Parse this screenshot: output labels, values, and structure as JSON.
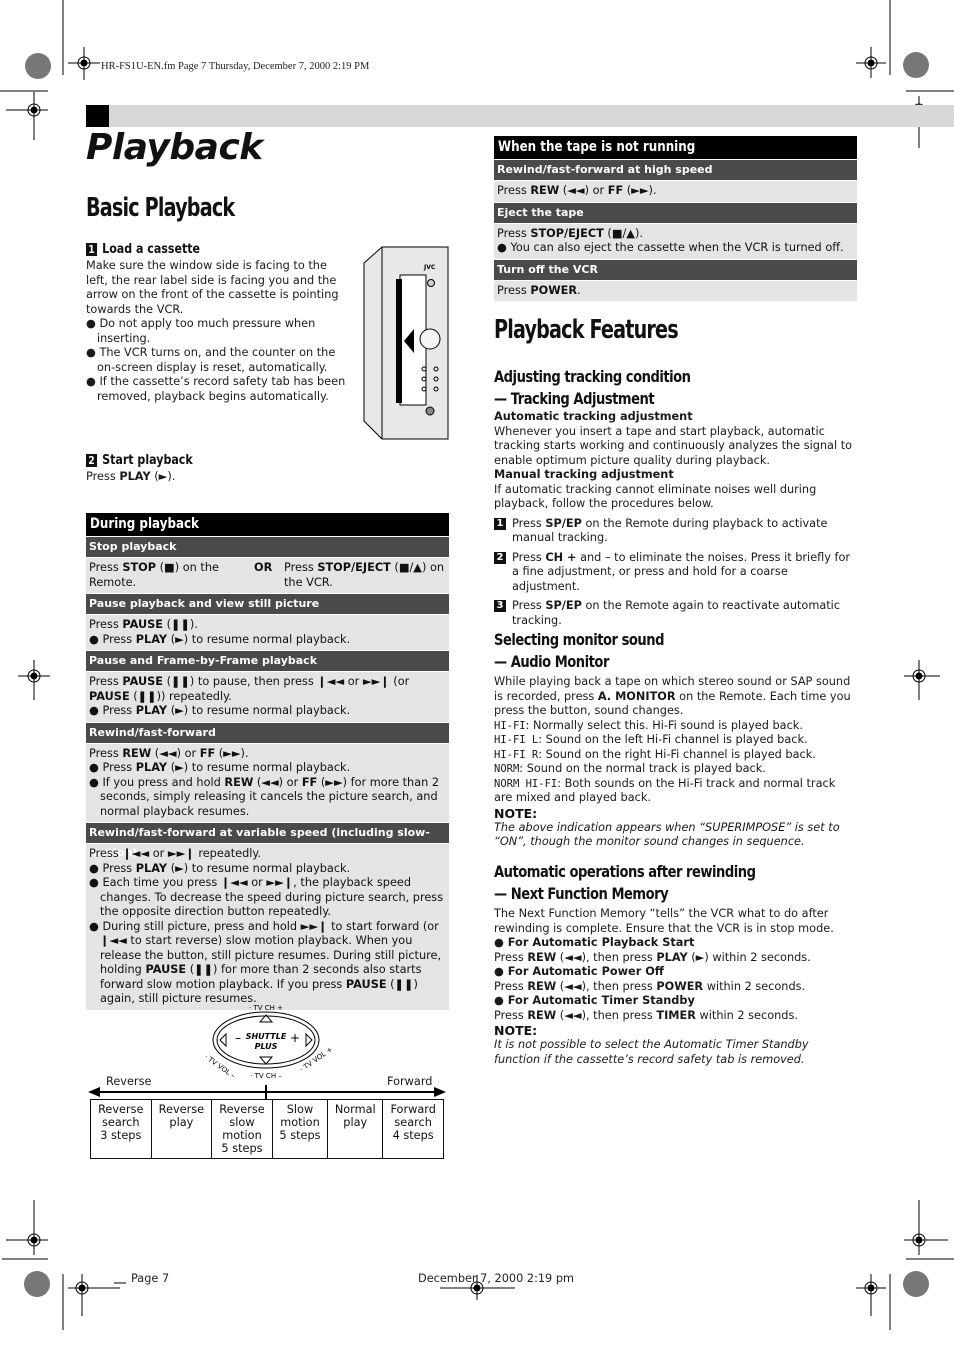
{
  "print_header": "HR-FS1U-EN.fm  Page 7  Thursday, December 7, 2000  2:19 PM",
  "page_title": "Playback",
  "left": {
    "section_title": "Basic Playback",
    "steps": [
      {
        "num": "1",
        "title": "Load a cassette",
        "text": "Make sure the window side is facing to the left, the rear label side is facing you and the arrow on the front of the cassette is pointing towards the VCR.",
        "bullets": [
          "Do not apply too much pressure when inserting.",
          "The VCR turns on, and the counter on the on-screen display is reset, automatically.",
          "If the cassette’s record safety tab has been removed, playback begins automatically."
        ]
      },
      {
        "num": "2",
        "title": "Start playback",
        "text_pre": "Press ",
        "text_bold": "PLAY",
        "text_post": " (►)."
      }
    ],
    "vcr_brand": "JVC",
    "during_table": {
      "title": "During playback",
      "stop": {
        "heading": "Stop playback",
        "left_pre": "Press ",
        "left_bold": "STOP",
        "left_post": " (■) on the Remote.",
        "or": "OR",
        "right_pre": "Press ",
        "right_bold": "STOP/EJECT",
        "right_post": " (■/▲) on the VCR."
      },
      "pause": {
        "heading": "Pause playback and view still picture",
        "line_pre": "Press ",
        "line_bold": "PAUSE",
        "line_post": " (❚❚).",
        "bullet_pre": "Press ",
        "bullet_bold": "PLAY",
        "bullet_post": " (►) to resume normal playback."
      },
      "frame": {
        "heading": "Pause and Frame-by-Frame playback",
        "line_pre": "Press ",
        "line_bold": "PAUSE",
        "line_mid": " (❚❚) to pause, then press ❙◄◄ or ►►❙ (or ",
        "line_bold2": "PAUSE",
        "line_post": " (❚❚)) repeatedly.",
        "bullet_pre": "Press ",
        "bullet_bold": "PLAY",
        "bullet_post": " (►) to resume normal playback."
      },
      "rewff": {
        "heading": "Rewind/fast-forward",
        "line_pre": "Press ",
        "line_bold": "REW",
        "line_mid": " (◄◄) or ",
        "line_bold2": "FF",
        "line_post": " (►►).",
        "bullet1_pre": "Press ",
        "bullet1_bold": "PLAY",
        "bullet1_post": " (►) to resume normal playback.",
        "bullet2_pre": "If you press and hold ",
        "bullet2_bold": "REW",
        "bullet2_mid": " (◄◄) or ",
        "bullet2_bold2": "FF",
        "bullet2_post": " (►►) for more than 2 seconds, simply releasing it cancels the picture search, and normal playback resumes."
      },
      "variable": {
        "heading": "Rewind/fast-forward at variable speed (including slow-motion)",
        "line": "Press ❙◄◄ or ►►❙ repeatedly.",
        "bullet1_pre": "Press ",
        "bullet1_bold": "PLAY",
        "bullet1_post": " (►) to resume normal playback.",
        "bullet2": "Each time you press ❙◄◄ or ►►❙, the playback speed changes. To decrease the speed during picture search, press the opposite direction button repeatedly.",
        "bullet3_a": "During still picture, press and hold ►►❙ to start forward (or ❙◄◄  to start reverse) slow motion playback. When you release the button, still picture resumes. During still picture, holding ",
        "bullet3_b": "PAUSE",
        "bullet3_c": " (❚❚) for more than 2 seconds also starts forward slow motion playback. If you press ",
        "bullet3_d": "PAUSE",
        "bullet3_e": " (❚❚) again, still picture resumes."
      }
    },
    "shuttle": {
      "dial_top": "· TV CH +",
      "dial_bottom": "· TV CH –",
      "dial_left": "· TV VOL –",
      "dial_right": "· TV VOL +",
      "dial_center_1": "SHUTTLE",
      "dial_center_2": "PLUS",
      "minus": "–",
      "plus": "+",
      "reverse_label": "Reverse",
      "forward_label": "Forward",
      "modes": [
        [
          "Reverse",
          "search",
          "3 steps"
        ],
        [
          "Reverse",
          "play"
        ],
        [
          "Reverse",
          "slow",
          "motion",
          "5 steps"
        ],
        [
          "Slow",
          "motion",
          "5 steps"
        ],
        [
          "Normal",
          "play"
        ],
        [
          "Forward",
          "search",
          "4 steps"
        ]
      ]
    }
  },
  "right": {
    "not_running_table": {
      "title": "When the tape is not running",
      "highspeed": {
        "heading": "Rewind/fast-forward at high speed",
        "line_pre": "Press ",
        "line_bold": "REW",
        "line_mid": " (◄◄) or ",
        "line_bold2": "FF",
        "line_post": " (►►)."
      },
      "eject": {
        "heading": "Eject the tape",
        "line_pre": "Press ",
        "line_bold": "STOP/EJECT",
        "line_post": " (■/▲).",
        "bullet": "You can also eject the cassette when the VCR is turned off."
      },
      "off": {
        "heading": "Turn off the VCR",
        "line_pre": "Press ",
        "line_bold": "POWER",
        "line_post": "."
      }
    },
    "section_title": "Playback Features",
    "tracking": {
      "title_1": "Adjusting tracking condition",
      "title_2": "— Tracking Adjustment",
      "auto_h": "Automatic tracking adjustment",
      "auto_text": "Whenever you insert a tape and start playback, automatic tracking starts working and continuously analyzes the signal to enable optimum picture quality during playback.",
      "manual_h": "Manual tracking adjustment",
      "manual_text": "If automatic tracking cannot eliminate noises well during playback, follow the procedures below.",
      "steps": [
        {
          "num": "1",
          "pre": "Press ",
          "bold": "SP/EP",
          "post": " on the Remote during playback to activate manual tracking."
        },
        {
          "num": "2",
          "pre": "Press ",
          "bold": "CH +",
          "post": " and – to eliminate the noises. Press it briefly for a fine adjustment, or press and hold for a coarse adjustment."
        },
        {
          "num": "3",
          "pre": "Press ",
          "bold": "SP/EP",
          "post": " on the Remote again to reactivate automatic tracking."
        }
      ]
    },
    "audio": {
      "title_1": "Selecting monitor sound",
      "title_2": "— Audio Monitor",
      "intro_pre": "While playing back a tape on which stereo sound or SAP sound is recorded, press ",
      "intro_bold": "A. MONITOR",
      "intro_post": " on the Remote. Each time you press the button, sound changes.",
      "modes": [
        {
          "code": "HI-FI",
          "text": ": Normally select this. Hi-Fi sound is played back."
        },
        {
          "code": "HI-FI L",
          "text": ": Sound on the left Hi-Fi channel is played back."
        },
        {
          "code": "HI-FI R",
          "text": ": Sound on the right Hi-Fi channel is played back."
        },
        {
          "code": "NORM",
          "text": ": Sound on the normal track is played back."
        },
        {
          "code": "NORM HI-FI",
          "text": ": Both sounds on the Hi-Fi track and normal track are mixed and played back."
        }
      ],
      "note_h": "NOTE:",
      "note": "The above indication appears when “SUPERIMPOSE” is set to “ON”, though the monitor sound changes in sequence."
    },
    "nfm": {
      "title_1": "Automatic operations after rewinding",
      "title_2": "— Next Function Memory",
      "intro": "The Next Function Memory “tells” the VCR what to do after rewinding is complete. Ensure that the VCR is in stop mode.",
      "items": [
        {
          "h": "For Automatic Playback Start",
          "pre": "Press ",
          "b1": "REW",
          "mid": " (◄◄), then press ",
          "b2": "PLAY",
          "post": " (►) within 2 seconds."
        },
        {
          "h": "For Automatic Power Off",
          "pre": "Press ",
          "b1": "REW",
          "mid": " (◄◄), then press ",
          "b2": "POWER",
          "post": " within 2 seconds."
        },
        {
          "h": "For Automatic Timer Standby",
          "pre": "Press ",
          "b1": "REW",
          "mid": " (◄◄), then press ",
          "b2": "TIMER",
          "post": " within 2 seconds."
        }
      ],
      "note_h": "NOTE:",
      "note": "It is not possible to select the Automatic Timer Standby function if the cassette’s record safety tab is removed."
    }
  },
  "footer": {
    "page": "Page 7",
    "date": "December 7, 2000 2:19 pm"
  }
}
